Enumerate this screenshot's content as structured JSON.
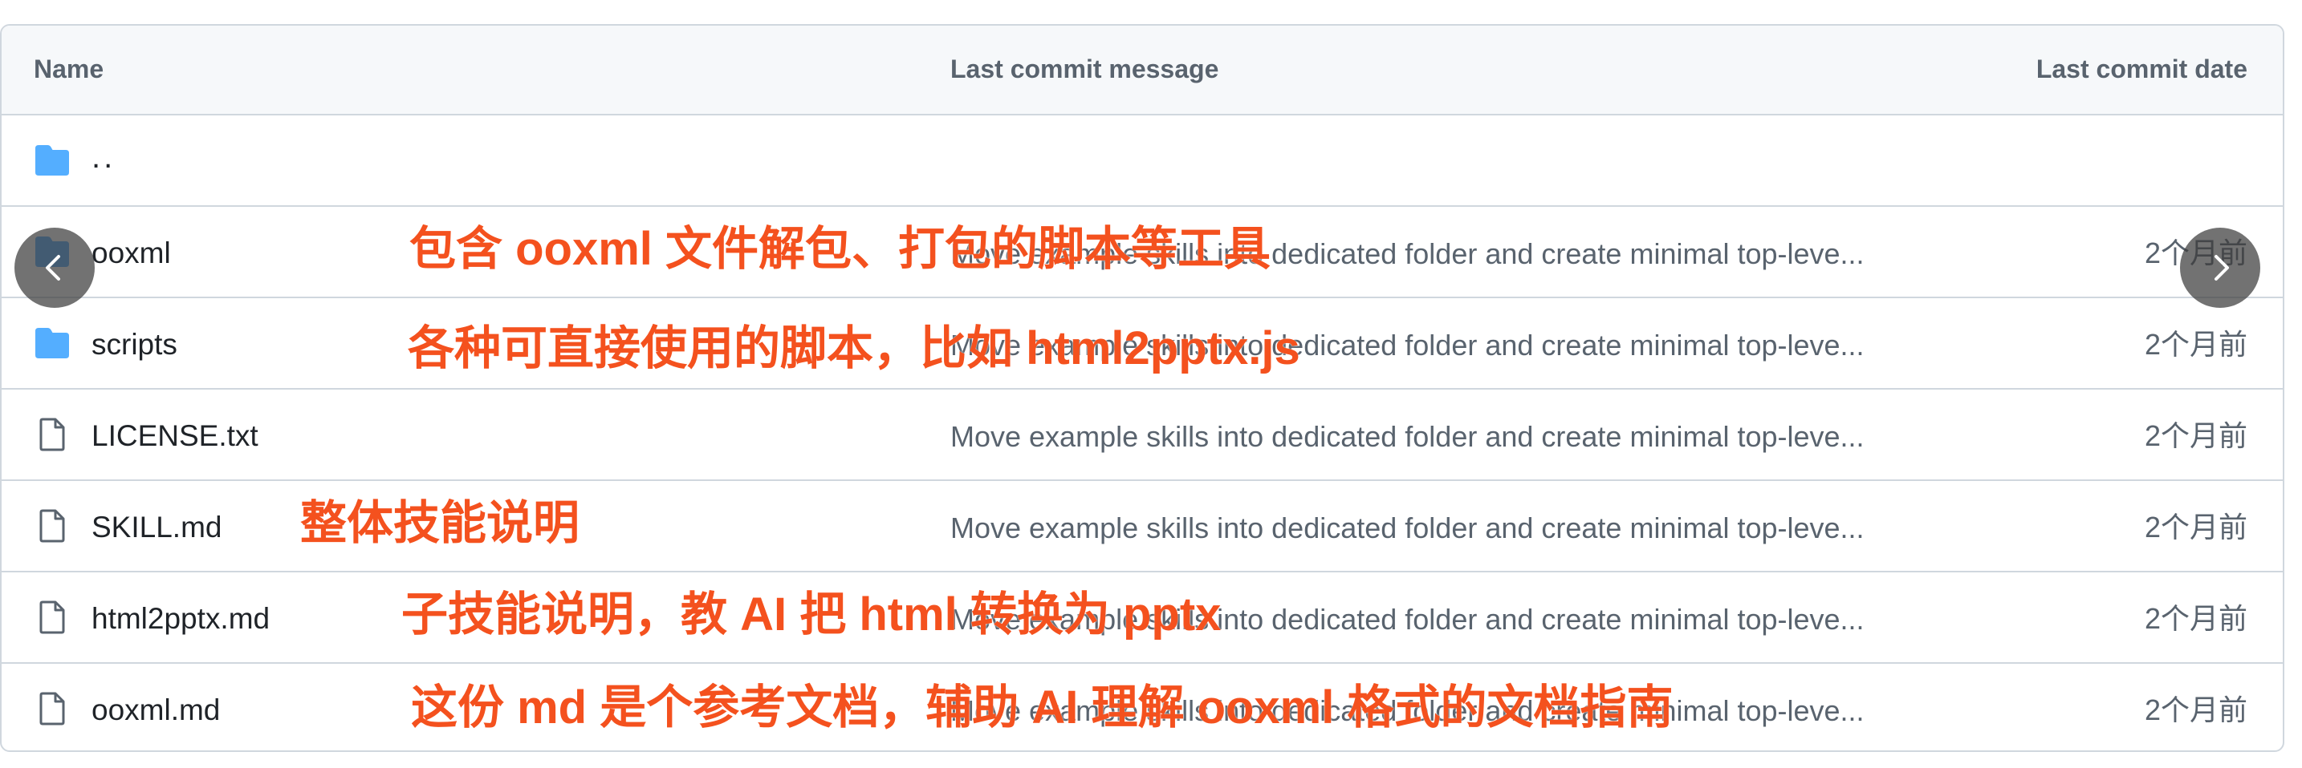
{
  "header": {
    "name": "Name",
    "message": "Last commit message",
    "date": "Last commit date"
  },
  "rows": [
    {
      "name": "..",
      "type": "folder",
      "message": "",
      "date": ""
    },
    {
      "name": "ooxml",
      "type": "folder",
      "message": "Move example skills into dedicated folder and create minimal top-leve...",
      "date": "2个月前"
    },
    {
      "name": "scripts",
      "type": "folder",
      "message": "Move example skills into dedicated folder and create minimal top-leve...",
      "date": "2个月前"
    },
    {
      "name": "LICENSE.txt",
      "type": "file",
      "message": "Move example skills into dedicated folder and create minimal top-leve...",
      "date": "2个月前"
    },
    {
      "name": "SKILL.md",
      "type": "file",
      "message": "Move example skills into dedicated folder and create minimal top-leve...",
      "date": "2个月前"
    },
    {
      "name": "html2pptx.md",
      "type": "file",
      "message": "Move example skills into dedicated folder and create minimal top-leve...",
      "date": "2个月前"
    },
    {
      "name": "ooxml.md",
      "type": "file",
      "message": "Move example skills into dedicated folder and create minimal top-leve...",
      "date": "2个月前"
    }
  ],
  "annotations": {
    "ooxml": "包含 ooxml 文件解包、打包的脚本等工具",
    "scripts": "各种可直接使用的脚本，比如 html2pptx.js",
    "skill": "整体技能说明",
    "html2pptx": "子技能说明，教 AI 把 html 转换为 pptx",
    "ooxml_md": "这份 md 是个参考文档，辅助 AI 理解 ooxml 格式的文档指南"
  },
  "icons": {
    "folder": "folder-icon",
    "file": "file-icon",
    "prev": "chevron-left-icon",
    "next": "chevron-right-icon"
  },
  "colors": {
    "folder": "#54aeff",
    "annotation": "#f4511e",
    "border": "#d0d7de",
    "header_bg": "#f6f8fa"
  }
}
